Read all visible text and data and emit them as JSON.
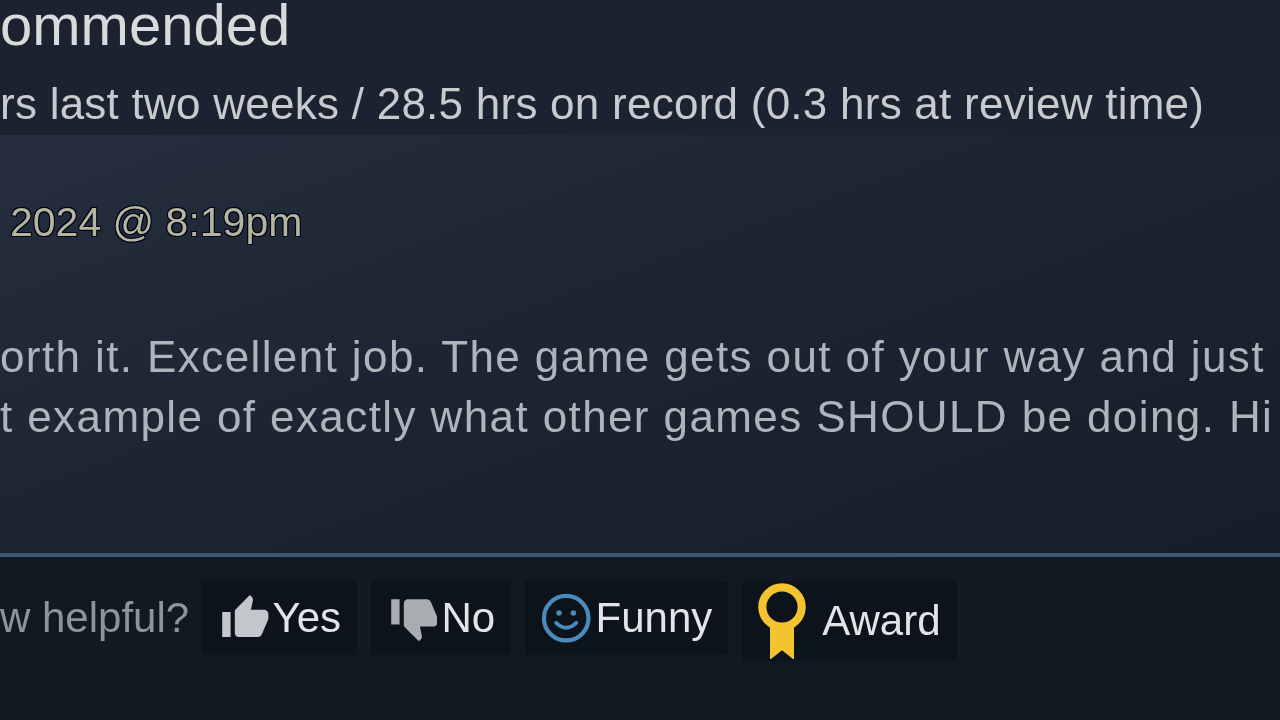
{
  "review": {
    "title": "ommended",
    "hours": "rs last two weeks / 28.5 hrs on record (0.3 hrs at review time)",
    "posted": "2024 @ 8:19pm",
    "body": [
      "orth it. Excellent job. The game gets out of your way and just",
      "t example of exactly what other games SHOULD be doing. Hi"
    ]
  },
  "helpful": {
    "prompt": "w helpful?",
    "buttons": [
      {
        "kind": "yes",
        "label": "Yes"
      },
      {
        "kind": "no",
        "label": "No"
      },
      {
        "kind": "funny",
        "label": "Funny"
      },
      {
        "kind": "award",
        "label": "Award"
      }
    ]
  }
}
